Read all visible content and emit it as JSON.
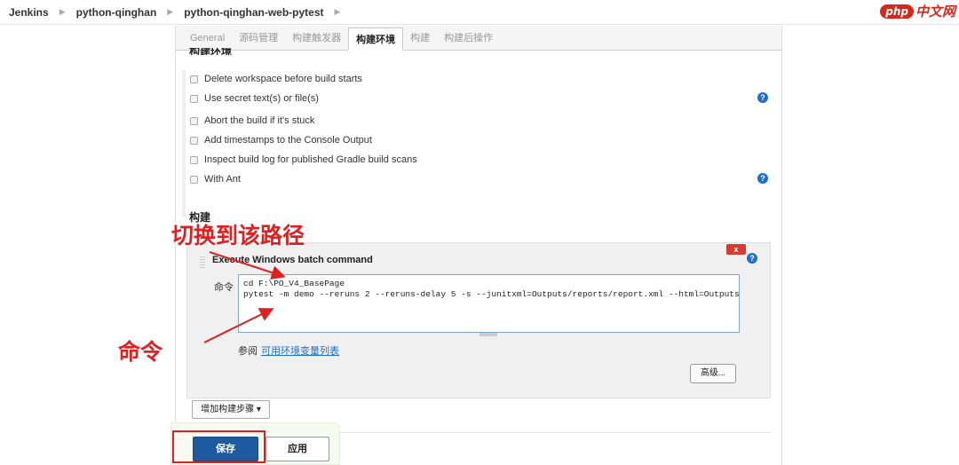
{
  "breadcrumb": [
    "Jenkins",
    "python-qinghan",
    "python-qinghan-web-pytest"
  ],
  "logo": {
    "php": "php",
    "cn": "中文网"
  },
  "tabs": [
    "General",
    "源码管理",
    "构建触发器",
    "构建环境",
    "构建",
    "构建后操作"
  ],
  "active_tab": "构建环境",
  "env_section_title": "构建环境",
  "env_options": [
    {
      "label": "Delete workspace before build starts",
      "checked": false
    },
    {
      "label": "Use secret text(s) or file(s)",
      "checked": false
    },
    {
      "label": "Abort the build if it's stuck",
      "checked": false
    },
    {
      "label": "Add timestamps to the Console Output",
      "checked": false
    },
    {
      "label": "Inspect build log for published Gradle build scans",
      "checked": false
    },
    {
      "label": "With Ant",
      "checked": false
    }
  ],
  "build_section_title": "构建",
  "build_step": {
    "title": "Execute Windows batch command",
    "delete_label": "x",
    "command_label": "命令",
    "command_value": "cd F:\\PO_V4_BasePage\npytest -m demo --reruns 2 --reruns-delay 5 -s --junitxml=Outputs/reports/report.xml --html=Outputs/a.html",
    "see_also_prefix": "参阅",
    "see_also_link": "可用环境变量列表",
    "advanced_button": "高级..."
  },
  "add_step_button": "增加构建步骤",
  "save_button": "保存",
  "apply_button": "应用",
  "help_icon_text": "?",
  "annotations": {
    "path": "切换到该路径",
    "command": "命令"
  },
  "colors": {
    "accent": "#1f6fd1",
    "annotation": "#e02020",
    "save": "#1f5aa0",
    "delete": "#d53b2f"
  }
}
